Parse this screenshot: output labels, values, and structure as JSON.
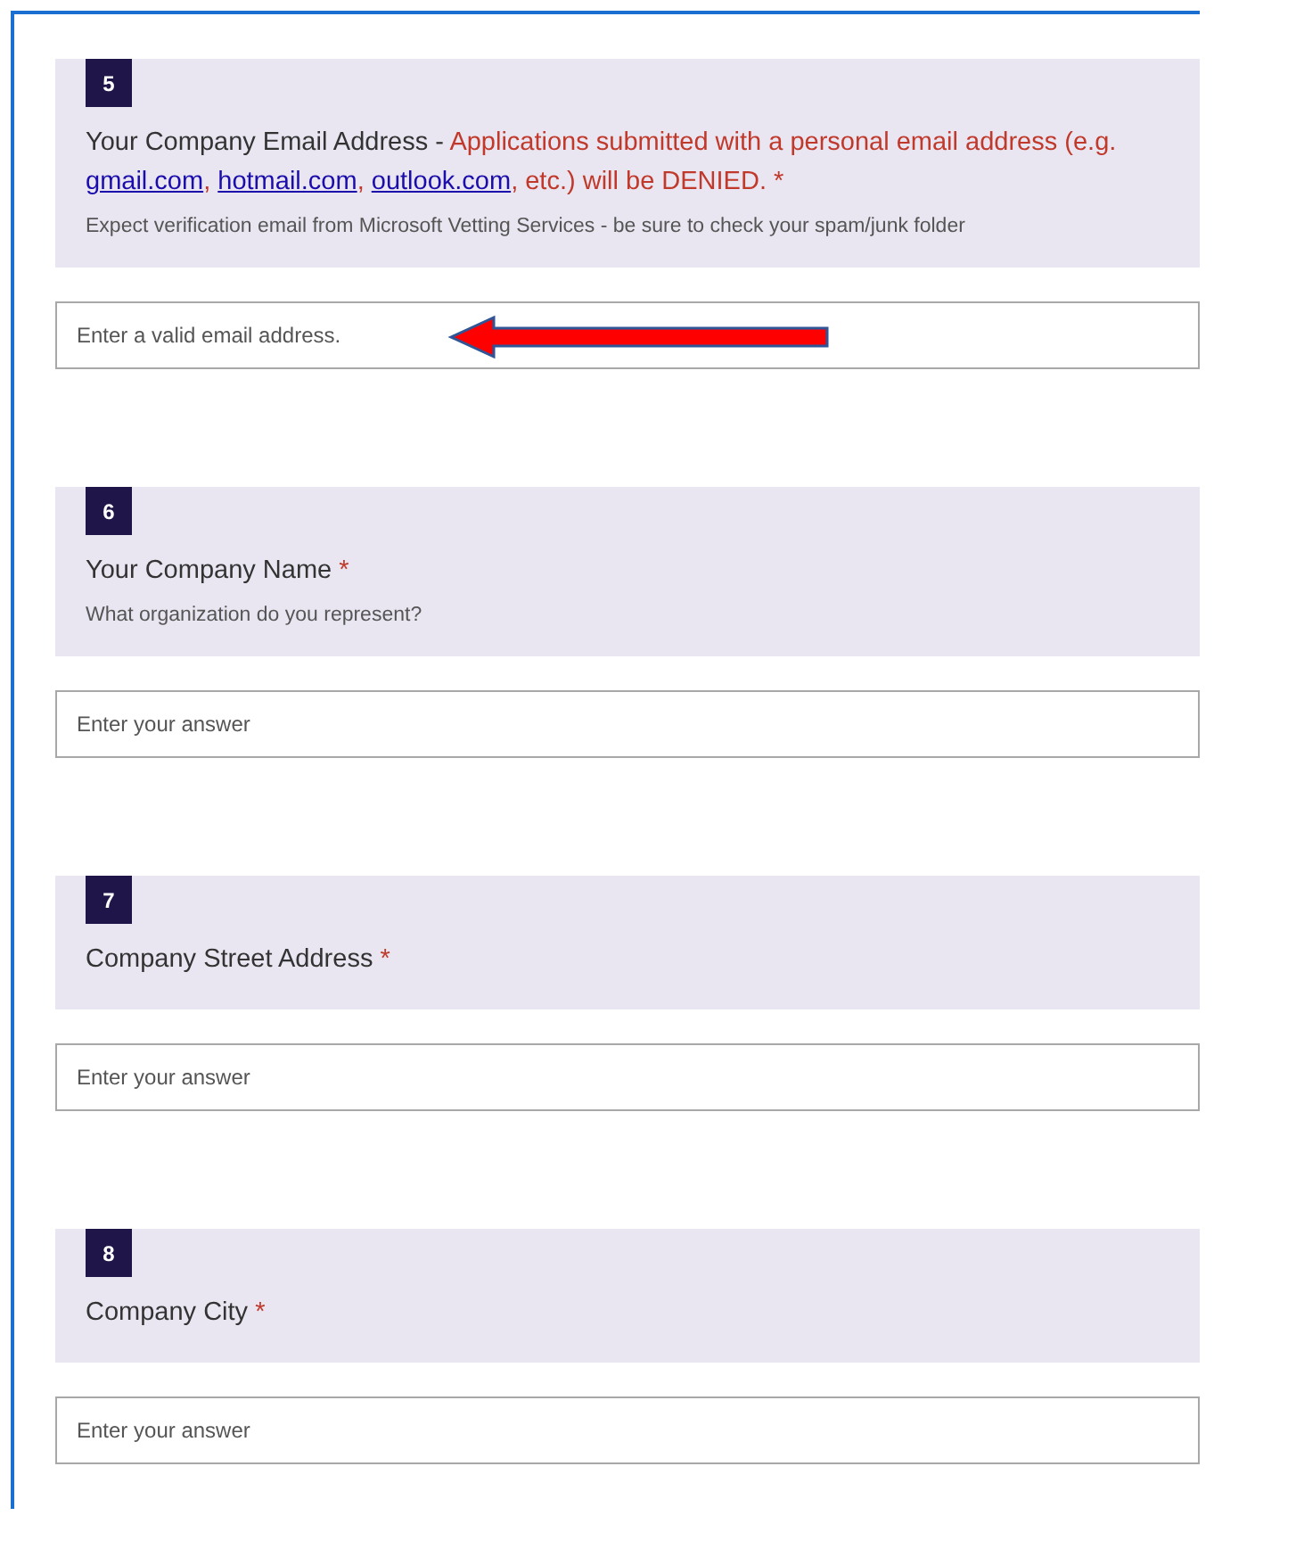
{
  "questions": [
    {
      "number": "5",
      "title": [
        {
          "kind": "plain",
          "text": "Your Company Email Address - "
        },
        {
          "kind": "warning",
          "text": "Applications submitted with a personal email address (e.g. "
        },
        {
          "kind": "link",
          "text": "gmail.com"
        },
        {
          "kind": "warning",
          "text": ", "
        },
        {
          "kind": "link",
          "text": "hotmail.com"
        },
        {
          "kind": "warning",
          "text": ", "
        },
        {
          "kind": "link",
          "text": "outlook.com"
        },
        {
          "kind": "warning",
          "text": ", etc.) will be DENIED."
        }
      ],
      "required_mark": "*",
      "subtitle": "Expect verification email from Microsoft Vetting Services - be sure to check your spam/junk folder",
      "placeholder": "Enter a valid email address.",
      "highlighted": true
    },
    {
      "number": "6",
      "title": [
        {
          "kind": "plain",
          "text": "Your Company Name"
        }
      ],
      "required_mark": "*",
      "subtitle": "What organization do you represent?",
      "placeholder": "Enter your answer",
      "highlighted": false
    },
    {
      "number": "7",
      "title": [
        {
          "kind": "plain",
          "text": "Company Street Address"
        }
      ],
      "required_mark": "*",
      "placeholder": "Enter your answer",
      "highlighted": false
    },
    {
      "number": "8",
      "title": [
        {
          "kind": "plain",
          "text": "Company City"
        }
      ],
      "required_mark": "*",
      "placeholder": "Enter your answer",
      "highlighted": false
    }
  ]
}
